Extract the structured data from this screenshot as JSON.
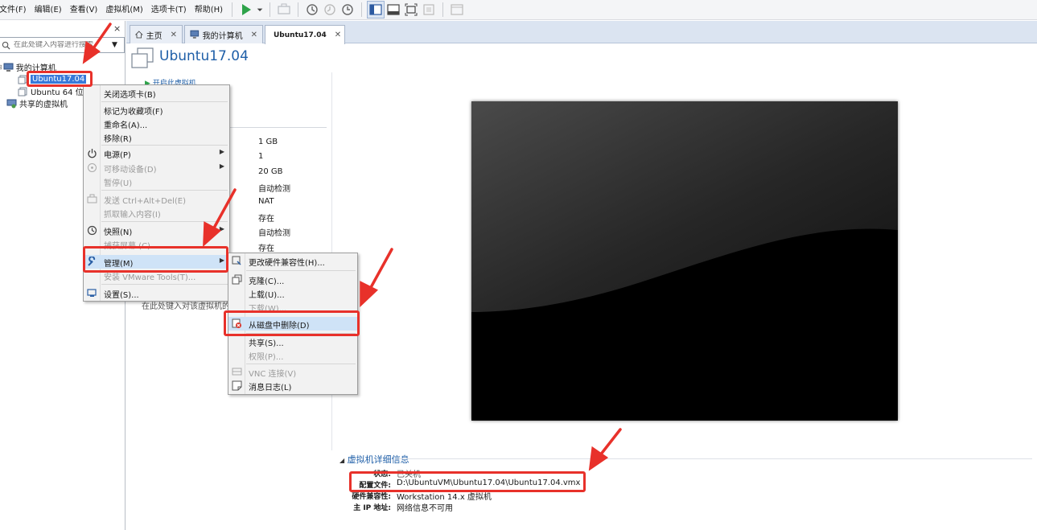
{
  "menubar": {
    "items": [
      "文件(F)",
      "编辑(E)",
      "查看(V)",
      "虚拟机(M)",
      "选项卡(T)",
      "帮助(H)"
    ]
  },
  "library": {
    "close": "×",
    "search_placeholder": "在此处键入内容进行搜索",
    "tree": {
      "my_computer": "我的计算机",
      "vm_selected": "Ubuntu17.04",
      "vm_other": "Ubuntu 64 位",
      "shared": "共享的虚拟机"
    }
  },
  "tabs": [
    {
      "label": "主页",
      "icon": "home-icon"
    },
    {
      "label": "我的计算机",
      "icon": "computer-icon"
    },
    {
      "label": "Ubuntu17.04",
      "icon": "vm-icon"
    }
  ],
  "vm": {
    "title": "Ubuntu17.04",
    "start_action": "开启此虚拟机",
    "device_values": [
      "1 GB",
      "1",
      "20 GB",
      "自动检测",
      "NAT",
      "存在",
      "自动检测",
      "存在"
    ],
    "description_hint": "在此处键入对该虚拟机的"
  },
  "context_menu": {
    "items": [
      "关闭选项卡(B)",
      "标记为收藏项(F)",
      "重命名(A)...",
      "移除(R)",
      "电源(P)",
      "可移动设备(D)",
      "暂停(U)",
      "发送 Ctrl+Alt+Del(E)",
      "抓取输入内容(I)",
      "快照(N)",
      "捕获屏幕 (C)",
      "管理(M)",
      "安装 VMware Tools(T)...",
      "设置(S)..."
    ]
  },
  "manage_submenu": {
    "items": [
      "更改硬件兼容性(H)...",
      "克隆(C)...",
      "上载(U)...",
      "下载(W)...",
      "从磁盘中删除(D)",
      "共享(S)...",
      "权限(P)...",
      "VNC 连接(V)",
      "消息日志(L)"
    ]
  },
  "details": {
    "header": "虚拟机详细信息",
    "rows": [
      {
        "label": "状态:",
        "value": "已关机"
      },
      {
        "label": "配置文件:",
        "value": "D:\\UbuntuVM\\Ubuntu17.04\\Ubuntu17.04.vmx"
      },
      {
        "label": "硬件兼容性:",
        "value": "Workstation 14.x 虚拟机"
      },
      {
        "label": "主 IP 地址:",
        "value": "网络信息不可用"
      }
    ]
  },
  "colors": {
    "accent": "#1f5fa8",
    "selection": "#3879d9",
    "annotation": "#e8312a"
  }
}
